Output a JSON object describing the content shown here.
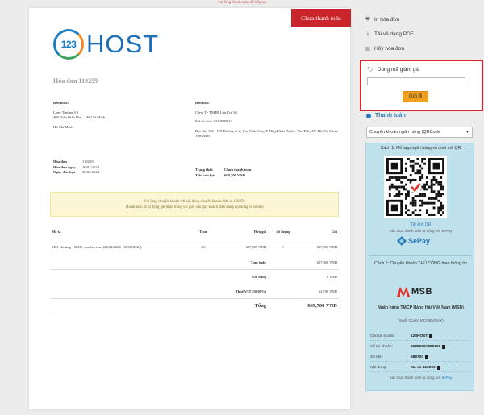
{
  "top_note": "Vui lòng thanh toán để tiếp tục",
  "invoice": {
    "status_button": "Chưa thanh toán",
    "logo_badge": "123",
    "logo_text": "HOST",
    "title": "Hóa đơn 119259",
    "buyer": {
      "label": "Bên mua:",
      "name": "Long Trương Vũ",
      "address": "400 Điện Biên Phủ, , Hồ Chí Minh",
      "city": "Hồ Chí Minh"
    },
    "seller": {
      "label": "Bên bán:",
      "company": "Công Ty TNHH Lưu Trữ Số",
      "tax": "Mã số thuế: 0312089232",
      "address": "Địa chỉ: 168 - 170 Đường số 2, Vạn Phúc City, P. Hiệp Bình Phước, Thủ Đức, TP. Hồ Chí Minh, Việt Nam"
    },
    "meta": {
      "invoice_label": "Hóa đơn",
      "invoice_value": "119259",
      "created_label": "Hóa đơn ngày",
      "created_value": "26/02/2024",
      "due_label": "Ngày đến hạn",
      "due_value": "26/02/2024",
      "status_label": "Trạng thái:",
      "status_value": "Chưa thanh toán",
      "remaining_label": "Tiền còn lại:",
      "remaining_value": "689,700 VND"
    },
    "notice_line1": "Vui lòng chuyển khoản với nội dung chuyển khoản: Ma so 119259",
    "notice_line2": "Thanh toán sẽ tự động ghi nhận trong vài giây sau quý khách điền đúng nội dung và số tiền",
    "table": {
      "headers": [
        "Mô tả",
        "Thuế",
        "Đơn giá",
        "Số lượng",
        "Giá"
      ],
      "rows": [
        [
          "SEO Hosting - SEO1 voucher.com (26/02/2024 - 25/08/2024)",
          "Có",
          "627,000 VND",
          "1",
          "627,000 VND"
        ]
      ],
      "subtotal_label": "Tạm tính:",
      "subtotal_value": "627,000 VND",
      "credit_label": "Tín dụng",
      "credit_value": "0 VND",
      "vat_label": "Thuế VAT (10.00%)",
      "vat_value": "62,700 VND",
      "total_label": "Tổng",
      "total_value": "689,700 VND"
    }
  },
  "sidebar": {
    "links": [
      {
        "icon": "printer-icon",
        "label": "In hóa đơn"
      },
      {
        "icon": "download-icon",
        "label": "Tải về dạng PDF"
      },
      {
        "icon": "file-icon",
        "label": "Hủy hóa đơn"
      }
    ],
    "coupon_label": "Dùng mã giảm giá",
    "coupon_placeholder": "",
    "coupon_button": "Gửi đi",
    "payment_title": "Thanh toán",
    "payment_method": "Chuyển khoản ngân hàng (QRCode",
    "method1": "Cách 1: Mở app ngân hàng và quét mã QR",
    "qr_download": "Tải ảnh QR",
    "qr_note": "Xác thực thanh toán tự động bởi SePay",
    "sepay_logo": "SePay",
    "method2": "Cách 2: Chuyển khoản THỦ CÔNG theo thông tin",
    "bank_logo": "MSB",
    "bank_name": "Ngân hàng TMCP Hàng Hải Việt Nam (MSB)",
    "swift": "(Swift Code: MCOBVNVX)",
    "details": [
      {
        "label": "Chủ tài khoản:",
        "value": "123HOST"
      },
      {
        "label": "Số tài khoản:",
        "value": "96886681886868"
      },
      {
        "label": "Số tiền:",
        "value": "689700"
      },
      {
        "label": "Nội dung:",
        "value": "Ma so 119259"
      }
    ],
    "footer_prefix": "Xác thực thanh toán tự động bởi ",
    "footer_brand": "SePay"
  },
  "colors": {
    "status_red": "#c9252b",
    "brand_blue": "#1c70b8",
    "coupon_button": "#f0a11e",
    "payment_panel": "#bfe1ec"
  }
}
